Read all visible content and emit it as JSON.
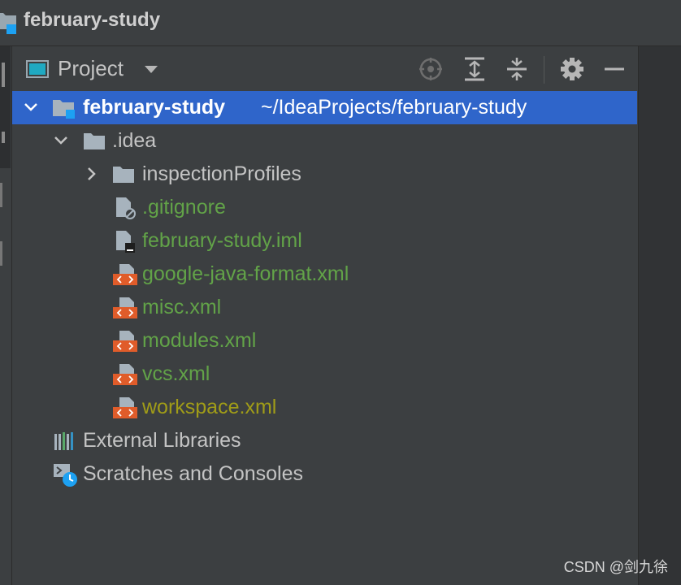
{
  "window": {
    "title": "february-study"
  },
  "panel": {
    "view_label": "Project",
    "toolbar": [
      {
        "name": "locate-icon"
      },
      {
        "name": "expand-all-icon"
      },
      {
        "name": "collapse-all-icon"
      },
      {
        "name": "gear-icon"
      },
      {
        "name": "minimize-icon"
      }
    ]
  },
  "tree": {
    "root": {
      "label": "february-study",
      "path": "~/IdeaProjects/february-study",
      "icon": "module-folder-icon"
    },
    "idea": {
      "label": ".idea",
      "icon": "folder-icon"
    },
    "inspection": {
      "label": "inspectionProfiles",
      "icon": "folder-icon"
    },
    "gitignore": {
      "label": ".gitignore",
      "icon": "ignored-file-icon",
      "color": "#62a348"
    },
    "iml": {
      "label": "february-study.iml",
      "icon": "iml-file-icon",
      "color": "#62a348"
    },
    "gjf": {
      "label": "google-java-format.xml",
      "icon": "xml-file-icon",
      "color": "#62a348"
    },
    "misc": {
      "label": "misc.xml",
      "icon": "xml-file-icon",
      "color": "#62a348"
    },
    "modules": {
      "label": "modules.xml",
      "icon": "xml-file-icon",
      "color": "#62a348"
    },
    "vcs": {
      "label": "vcs.xml",
      "icon": "xml-file-icon",
      "color": "#62a348"
    },
    "workspace": {
      "label": "workspace.xml",
      "icon": "xml-file-icon",
      "color": "#a09c18"
    },
    "libraries": {
      "label": "External Libraries",
      "icon": "library-icon"
    },
    "scratches": {
      "label": "Scratches and Consoles",
      "icon": "scratches-icon"
    }
  },
  "colors": {
    "selection": "#2f65ca",
    "added_file": "#62a348",
    "modified_file": "#a09c18",
    "xml_badge": "#e05c2a",
    "background": "#3c3f41"
  },
  "watermark": "CSDN @剑九徐"
}
